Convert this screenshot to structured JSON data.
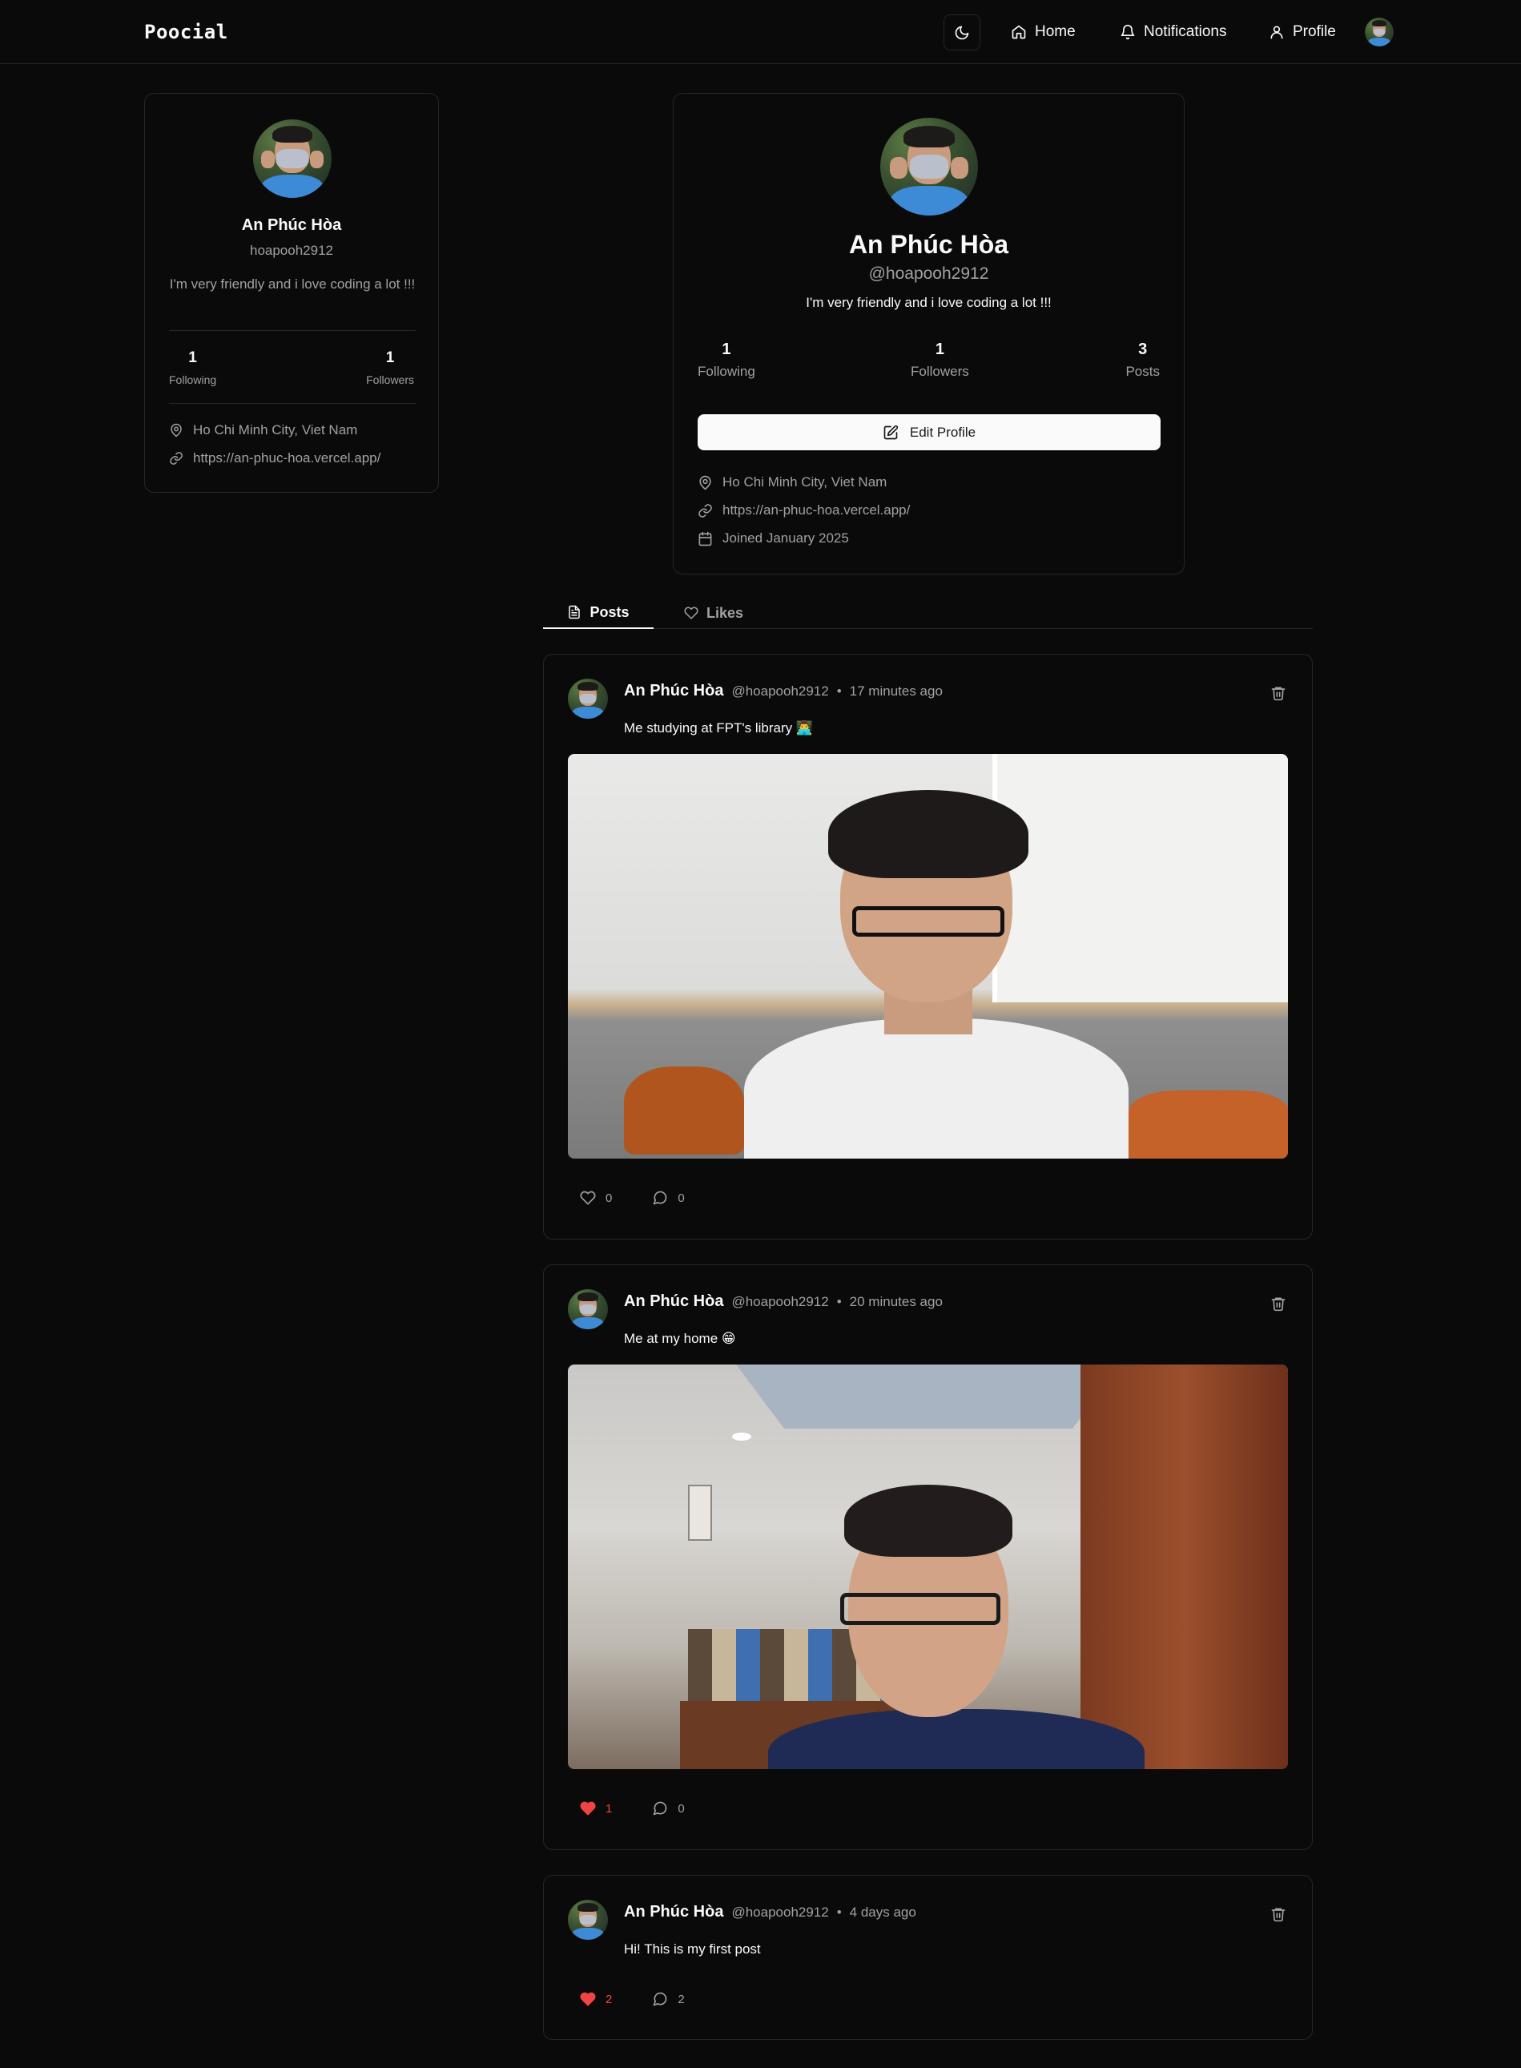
{
  "nav": {
    "brand": "Poocial",
    "home": "Home",
    "notifications": "Notifications",
    "profile": "Profile"
  },
  "sidebar": {
    "name": "An Phúc Hòa",
    "username": "hoapooh2912",
    "bio": "I'm very friendly and i love coding a lot !!!",
    "following_count": "1",
    "following_label": "Following",
    "followers_count": "1",
    "followers_label": "Followers",
    "location": "Ho Chi Minh City, Viet Nam",
    "website": "https://an-phuc-hoa.vercel.app/"
  },
  "profile": {
    "name": "An Phúc Hòa",
    "username": "@hoapooh2912",
    "bio": "I'm very friendly and i love coding a lot !!!",
    "following_count": "1",
    "following_label": "Following",
    "followers_count": "1",
    "followers_label": "Followers",
    "posts_count": "3",
    "posts_label": "Posts",
    "edit_label": "Edit Profile",
    "location": "Ho Chi Minh City, Viet Nam",
    "website": "https://an-phuc-hoa.vercel.app/",
    "joined": "Joined January 2025"
  },
  "tabs": {
    "posts": "Posts",
    "likes": "Likes"
  },
  "posts": [
    {
      "author": "An Phúc Hòa",
      "handle": "@hoapooh2912",
      "time": "17 minutes ago",
      "content": "Me studying at FPT's library 👨‍💻",
      "likes": "0",
      "comments": "0",
      "liked": false
    },
    {
      "author": "An Phúc Hòa",
      "handle": "@hoapooh2912",
      "time": "20 minutes ago",
      "content": "Me at my home 😁",
      "likes": "1",
      "comments": "0",
      "liked": true
    },
    {
      "author": "An Phúc Hòa",
      "handle": "@hoapooh2912",
      "time": "4 days ago",
      "content": "Hi! This is my first post",
      "likes": "2",
      "comments": "2",
      "liked": true
    }
  ],
  "colors": {
    "background": "#0a0a0a",
    "border": "#262626",
    "muted_text": "#a1a1a1",
    "like_red": "#ef4444"
  }
}
